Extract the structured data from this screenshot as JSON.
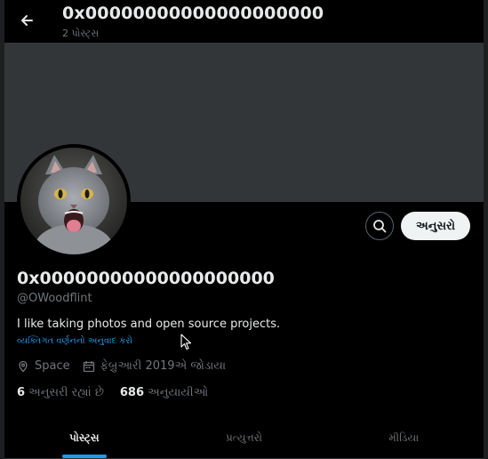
{
  "header": {
    "title": "0x00000000000000000000",
    "subtitle": "2 પોસ્ટ્સ"
  },
  "profile": {
    "display_name": "0x00000000000000000000",
    "handle": "@OWoodflint",
    "bio": "I like taking photos and open source projects.",
    "translate_link": "વ્યક્તિગત વર્ણનનો અનુવાદ કરો",
    "location": "Space",
    "joined": "ફેબ્રુઆરી 2019એ જોડાયા",
    "following_count": "6",
    "following_label": "અનુસરી રહ્યાં છે",
    "followers_count": "686",
    "followers_label": "અનુયાયીઓ"
  },
  "actions": {
    "follow_label": "અનુસરો"
  },
  "tabs": [
    {
      "label": "પોસ્ટ્સ",
      "active": true
    },
    {
      "label": "પ્રત્યુત્તરો",
      "active": false
    },
    {
      "label": "મીડિયા",
      "active": false
    }
  ],
  "colors": {
    "accent": "#1d9bf0",
    "banner": "#333639",
    "background": "#000000"
  },
  "icons": {
    "back": "arrow-left-icon",
    "search": "search-icon",
    "location": "location-pin-icon",
    "calendar": "calendar-icon"
  }
}
